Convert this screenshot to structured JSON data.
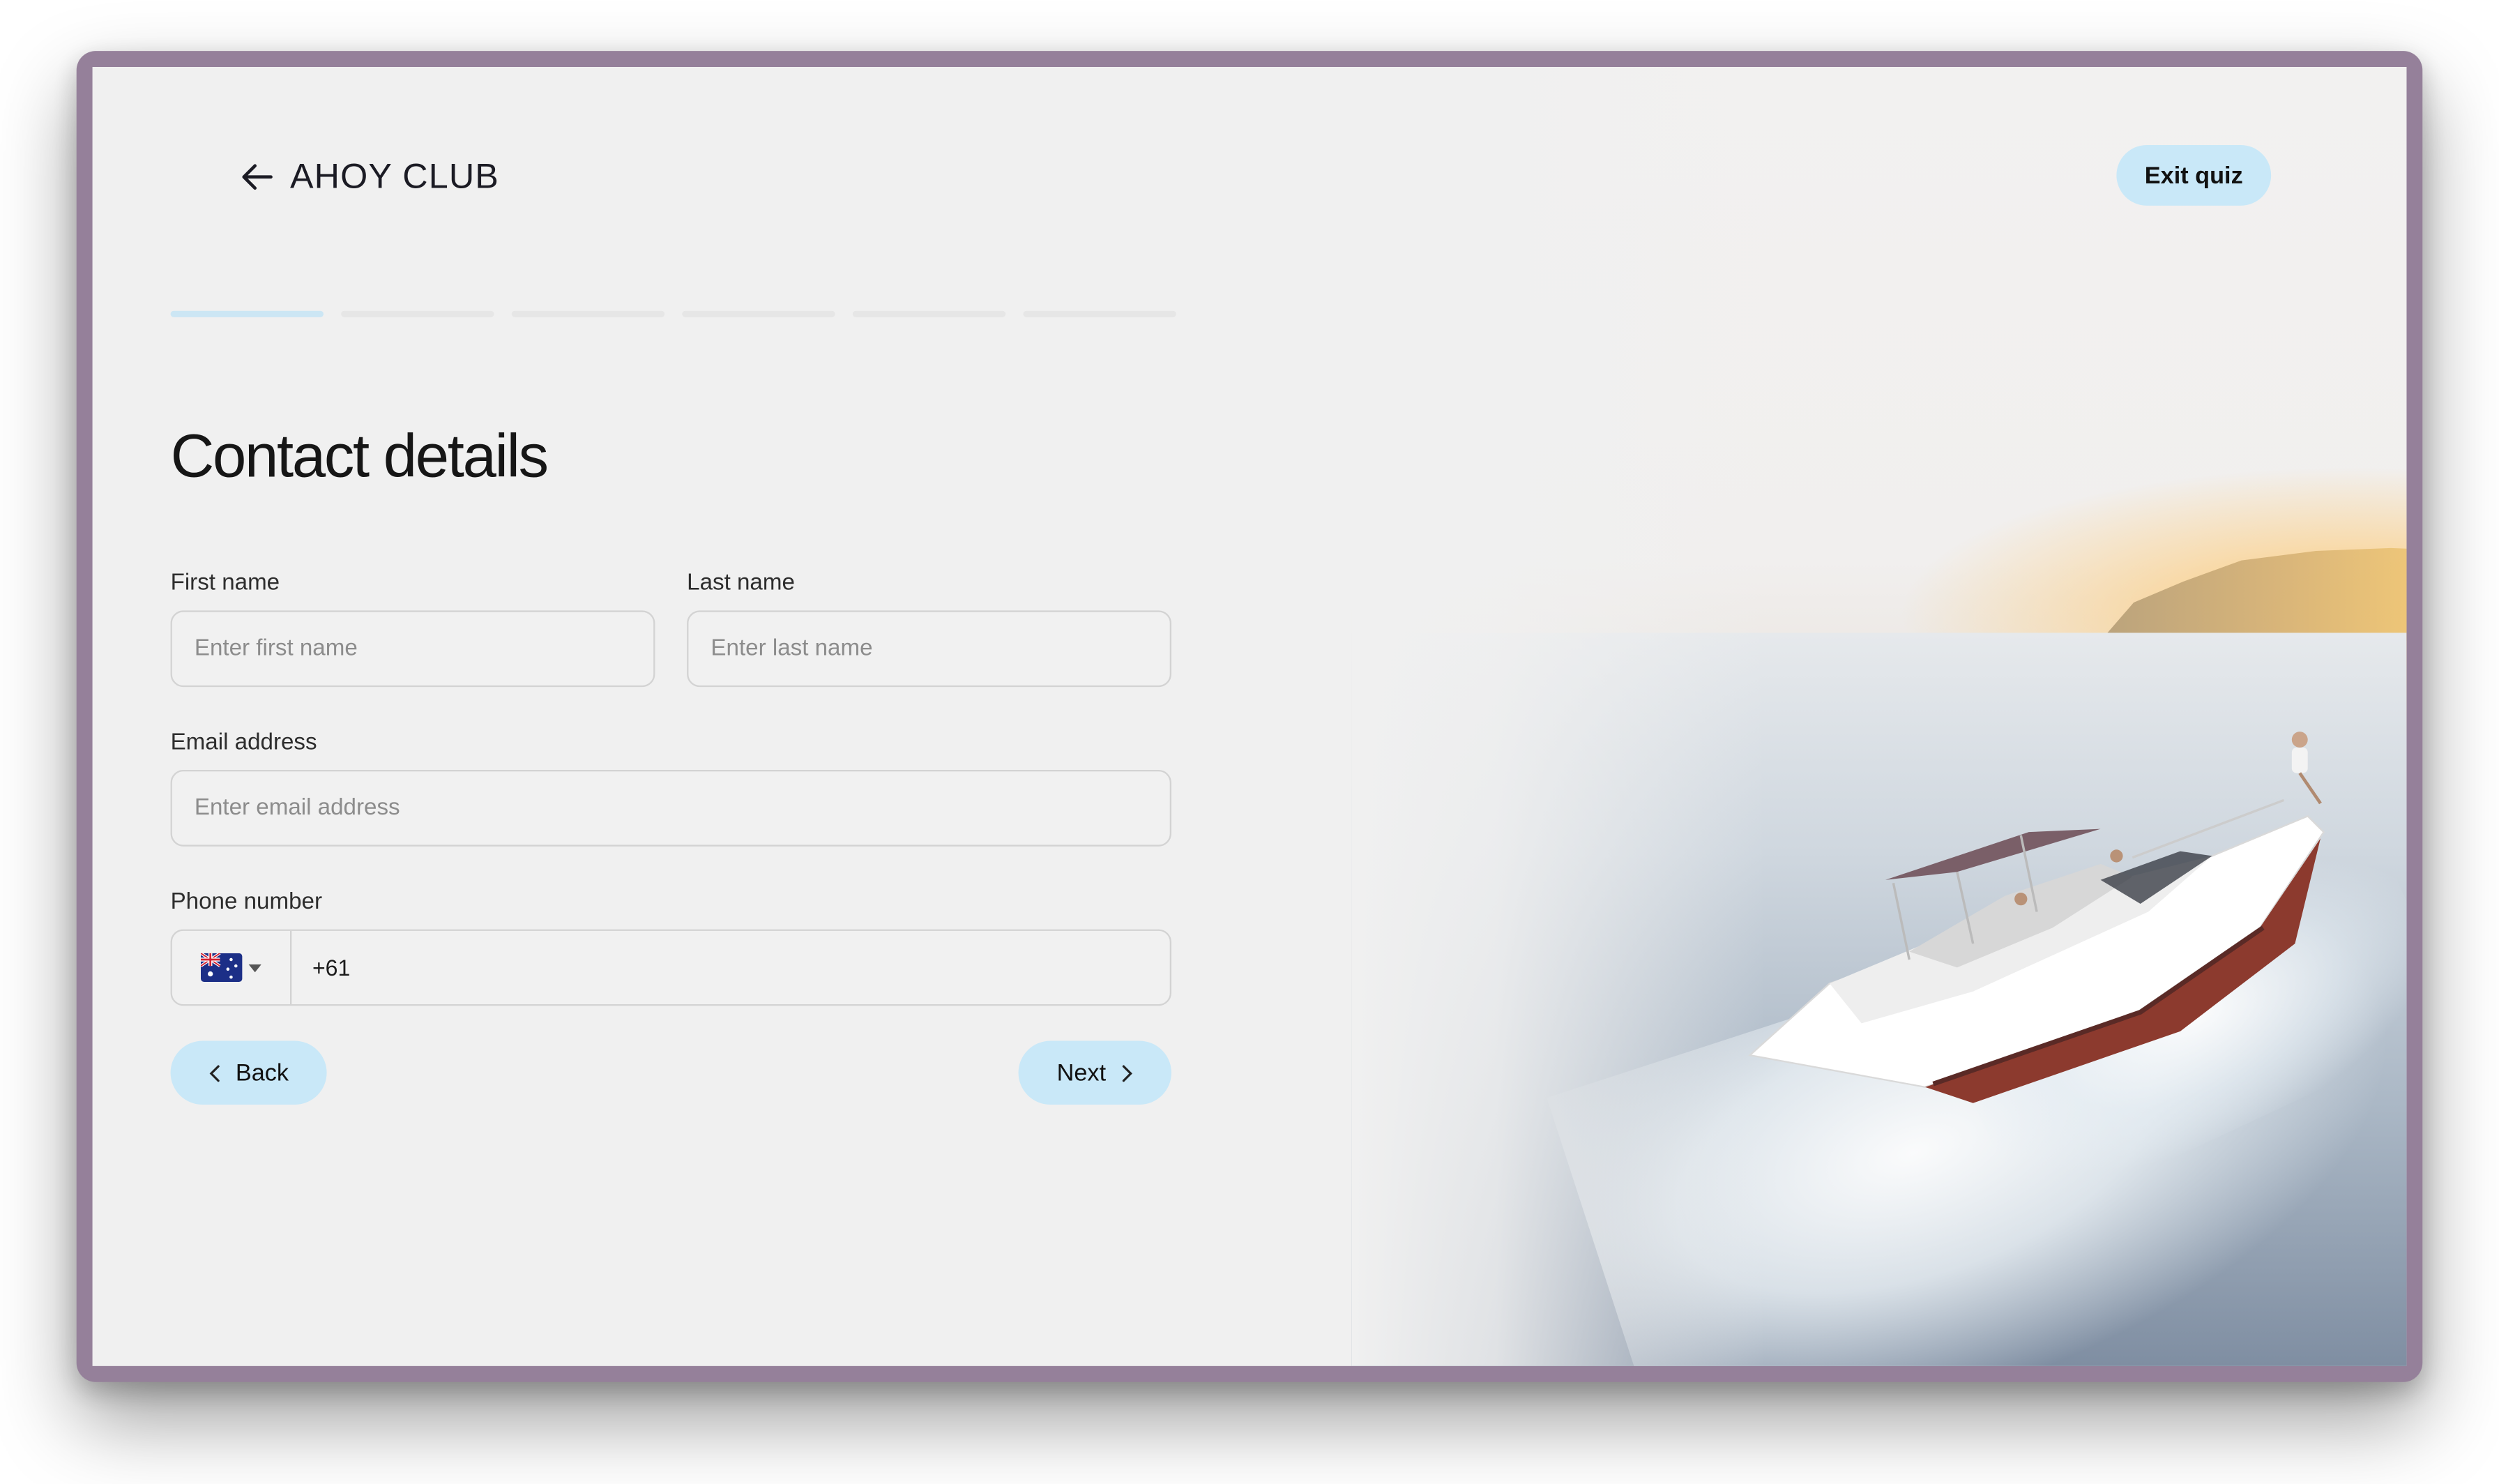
{
  "header": {
    "brand": "AHOY CLUB",
    "exit_label": "Exit quiz"
  },
  "progress": {
    "total_steps": 6,
    "current_step": 1
  },
  "form": {
    "title": "Contact details",
    "first_name": {
      "label": "First name",
      "placeholder": "Enter first name",
      "value": ""
    },
    "last_name": {
      "label": "Last name",
      "placeholder": "Enter last name",
      "value": ""
    },
    "email": {
      "label": "Email address",
      "placeholder": "Enter email address",
      "value": ""
    },
    "phone": {
      "label": "Phone number",
      "country_flag": "australia-flag",
      "dial_code": "+61"
    }
  },
  "nav": {
    "back_label": "Back",
    "next_label": "Next"
  },
  "colors": {
    "accent": "#c9e8f8",
    "background": "#f0f0f0",
    "text": "#161616"
  },
  "icons": [
    "back-arrow-icon",
    "chevron-down-icon",
    "chevron-left-icon",
    "chevron-right-icon"
  ]
}
